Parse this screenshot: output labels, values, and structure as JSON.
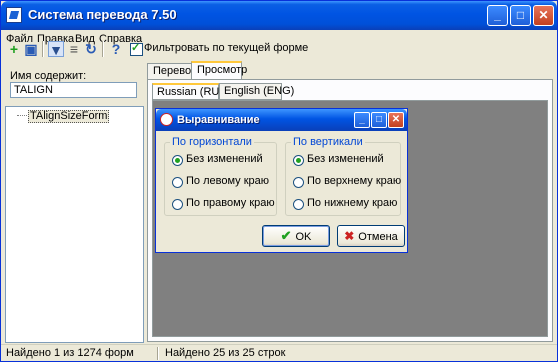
{
  "window": {
    "title": "Система перевода 7.50"
  },
  "menu": [
    "Файл",
    "Правка",
    "Вид",
    "Справка"
  ],
  "toolbar": {
    "filter_label": "Фильтровать по текущей форме",
    "filter_checked": true
  },
  "left": {
    "search_label": "Имя содержит:",
    "search_value": "TALIGN",
    "tree_items": [
      "TAlignSizeForm"
    ]
  },
  "tabs": [
    "Перевод",
    "Просмотр"
  ],
  "active_tab": "Просмотр",
  "subtabs": [
    "Russian (RUS)",
    "English (ENG)"
  ],
  "dialog": {
    "title": "Выравнивание",
    "horizontal": {
      "title": "По горизонтали",
      "options": [
        "Без изменений",
        "По левому краю",
        "По правому краю"
      ],
      "selected": "Без изменений"
    },
    "vertical": {
      "title": "По вертикали",
      "options": [
        "Без изменений",
        "По верхнему краю",
        "По нижнему краю"
      ],
      "selected": "Без изменений"
    },
    "ok_label": "OK",
    "cancel_label": "Отмена"
  },
  "status": {
    "left": "Найдено 1 из 1274 форм",
    "right": "Найдено 25 из 25 строк"
  },
  "colors": {
    "title_blue": "#0054e3",
    "tab_highlight": "#ffc83c",
    "preview_background": "#808080"
  }
}
